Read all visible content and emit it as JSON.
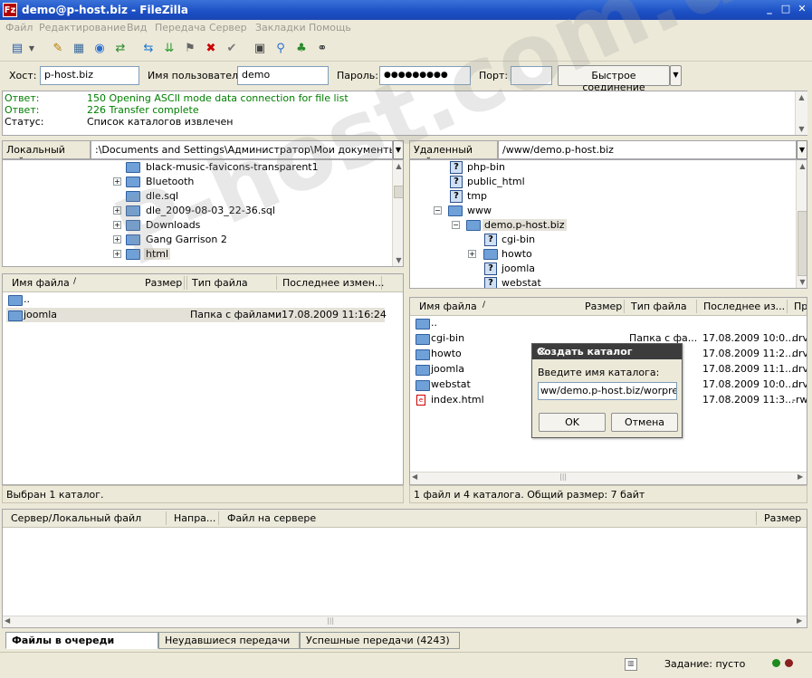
{
  "window": {
    "title": "demo@p-host.biz - FileZilla",
    "app_icon": "Fz"
  },
  "menu": [
    "Файл",
    "Редактирование",
    "Вид",
    "Передача",
    "Сервер",
    "Закладки",
    "Помощь"
  ],
  "toolbar_icons": [
    "site-manager-icon",
    "dropdown-icon",
    "message-log-icon",
    "local-tree-icon",
    "remote-tree-icon",
    "transfer-queue-icon",
    "refresh-icon",
    "process-queue-icon",
    "cancel-icon",
    "disconnect-icon",
    "reconnect-icon",
    "filter-icon",
    "compare-icon",
    "sync-browse-icon",
    "search-icon"
  ],
  "quickconnect": {
    "host_label": "Хост:",
    "host_value": "p-host.biz",
    "user_label": "Имя пользователя",
    "user_value": "demo",
    "pass_label": "Пароль:",
    "pass_value": "●●●●●●●●●",
    "port_label": "Порт:",
    "port_value": "",
    "connect_label": "Быстрое соединение"
  },
  "log": [
    {
      "kind": "Ответ:",
      "text": "150 Opening ASCII mode data connection for file list",
      "color": "#008000"
    },
    {
      "kind": "Ответ:",
      "text": "226 Transfer complete",
      "color": "#008000"
    },
    {
      "kind": "Статус:",
      "text": "Список каталогов извлечен",
      "color": "#000000"
    }
  ],
  "local": {
    "site_label": "Локальный сайт:",
    "path": ":\\Documents and Settings\\Администратор\\Мои документы\\html\\",
    "tree": [
      {
        "name": "black-music-favicons-transparent1",
        "expander": ""
      },
      {
        "name": "Bluetooth",
        "expander": "+"
      },
      {
        "name": "dle.sql",
        "expander": ""
      },
      {
        "name": "dle_2009-08-03_22-36.sql",
        "expander": "+"
      },
      {
        "name": "Downloads",
        "expander": "+"
      },
      {
        "name": "Gang Garrison 2",
        "expander": "+"
      },
      {
        "name": "html",
        "expander": "+"
      }
    ],
    "headers": {
      "name": "Имя файла",
      "size": "Размер",
      "type": "Тип файла",
      "modified": "Последнее измен..."
    },
    "files": [
      {
        "name": "..",
        "size": "",
        "type": "",
        "modified": ""
      },
      {
        "name": "joomla",
        "size": "",
        "type": "Папка с файлами",
        "modified": "17.08.2009 11:16:24"
      }
    ],
    "status": "Выбран 1 каталог."
  },
  "remote": {
    "site_label": "Удаленный сайт:",
    "path": "/www/demo.p-host.biz",
    "tree": [
      {
        "name": "php-bin",
        "icon": "unknown",
        "level": 1,
        "expander": ""
      },
      {
        "name": "public_html",
        "icon": "unknown",
        "level": 1,
        "expander": ""
      },
      {
        "name": "tmp",
        "icon": "unknown",
        "level": 1,
        "expander": ""
      },
      {
        "name": "www",
        "icon": "folder",
        "level": 1,
        "expander": "−"
      },
      {
        "name": "demo.p-host.biz",
        "icon": "folder",
        "level": 2,
        "expander": "−"
      },
      {
        "name": "cgi-bin",
        "icon": "unknown",
        "level": 3,
        "expander": ""
      },
      {
        "name": "howto",
        "icon": "folder",
        "level": 3,
        "expander": "+"
      },
      {
        "name": "joomla",
        "icon": "unknown",
        "level": 3,
        "expander": ""
      },
      {
        "name": "webstat",
        "icon": "unknown",
        "level": 3,
        "expander": ""
      }
    ],
    "headers": {
      "name": "Имя файла",
      "size": "Размер",
      "type": "Тип файла",
      "modified": "Последнее из...",
      "perm": "Пр"
    },
    "files": [
      {
        "name": "..",
        "type": "",
        "modified": "",
        "perm": "",
        "icon": "folder"
      },
      {
        "name": "cgi-bin",
        "type": "Папка с фа...",
        "modified": "17.08.2009 10:0...",
        "perm": "drv",
        "icon": "folder"
      },
      {
        "name": "howto",
        "type": "",
        "modified": "17.08.2009 11:2...",
        "perm": "drv",
        "icon": "folder"
      },
      {
        "name": "joomla",
        "type": "",
        "modified": "17.08.2009 11:1...",
        "perm": "drv",
        "icon": "folder"
      },
      {
        "name": "webstat",
        "type": "",
        "modified": "17.08.2009 10:0...",
        "perm": "drv",
        "icon": "folder"
      },
      {
        "name": "index.html",
        "type": "",
        "modified": "17.08.2009 11:3...",
        "perm": "-rw",
        "icon": "file"
      }
    ],
    "status": "1 файл и 4 каталога. Общий размер: 7 байт"
  },
  "dialog": {
    "title": "Создать каталог",
    "prompt": "Введите имя каталога:",
    "value": "ww/demo.p-host.biz/worpress",
    "ok": "OK",
    "cancel": "Отмена"
  },
  "queue": {
    "headers": {
      "server": "Сервер/Локальный файл",
      "direction": "Напра...",
      "remote": "Файл на сервере",
      "size": "Размер"
    },
    "tabs": [
      "Файлы в очереди",
      "Неудавшиеся передачи",
      "Успешные передачи (4243)"
    ],
    "task": "Задание: пусто"
  },
  "watermark": "P-host.com.ua"
}
